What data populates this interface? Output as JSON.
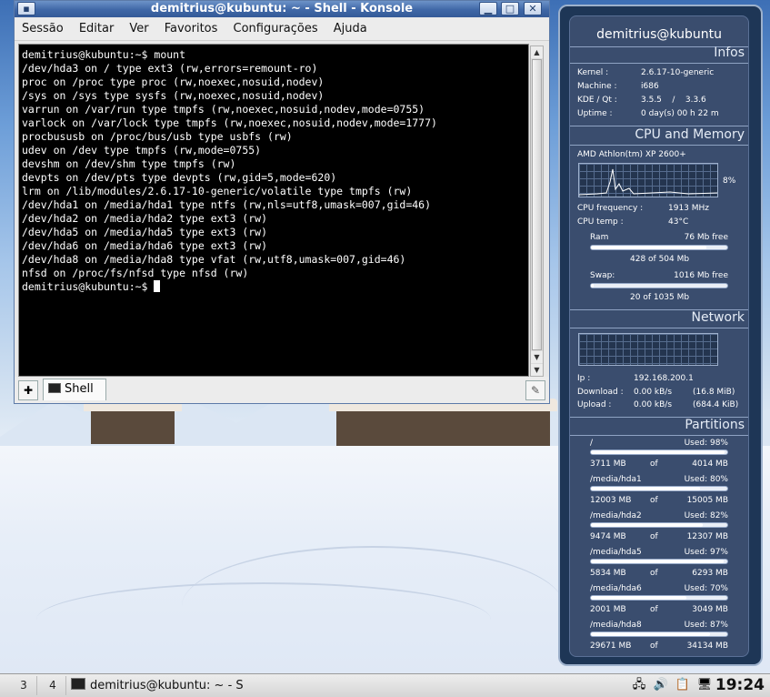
{
  "window": {
    "title": "demitrius@kubuntu: ~ - Shell - Konsole",
    "menu": [
      "Sessão",
      "Editar",
      "Ver",
      "Favoritos",
      "Configurações",
      "Ajuda"
    ]
  },
  "terminal": {
    "lines": [
      "demitrius@kubuntu:~$ mount",
      "/dev/hda3 on / type ext3 (rw,errors=remount-ro)",
      "proc on /proc type proc (rw,noexec,nosuid,nodev)",
      "/sys on /sys type sysfs (rw,noexec,nosuid,nodev)",
      "varrun on /var/run type tmpfs (rw,noexec,nosuid,nodev,mode=0755)",
      "varlock on /var/lock type tmpfs (rw,noexec,nosuid,nodev,mode=1777)",
      "procbususb on /proc/bus/usb type usbfs (rw)",
      "udev on /dev type tmpfs (rw,mode=0755)",
      "devshm on /dev/shm type tmpfs (rw)",
      "devpts on /dev/pts type devpts (rw,gid=5,mode=620)",
      "lrm on /lib/modules/2.6.17-10-generic/volatile type tmpfs (rw)",
      "/dev/hda1 on /media/hda1 type ntfs (rw,nls=utf8,umask=007,gid=46)",
      "/dev/hda2 on /media/hda2 type ext3 (rw)",
      "/dev/hda5 on /media/hda5 type ext3 (rw)",
      "/dev/hda6 on /media/hda6 type ext3 (rw)",
      "/dev/hda8 on /media/hda8 type vfat (rw,utf8,umask=007,gid=46)",
      "nfsd on /proc/fs/nfsd type nfsd (rw)"
    ],
    "prompt": "demitrius@kubuntu:~$ "
  },
  "tabs": [
    {
      "label": "Shell"
    }
  ],
  "monitor": {
    "hostname": "demitrius@kubuntu",
    "infos_title": "Infos",
    "kernel_label": "Kernel :",
    "kernel": "2.6.17-10-generic",
    "machine_label": "Machine :",
    "machine": "i686",
    "kde_label": "KDE / Qt :",
    "kde": "3.5.5",
    "kde_sep": "/",
    "qt": "3.3.6",
    "uptime_label": "Uptime :",
    "uptime": "0 day(s)  00 h 22 m",
    "cpu_title": "CPU and Memory",
    "cpu_model": "AMD Athlon(tm) XP 2600+",
    "cpu_usage": "8%",
    "cpu_freq_label": "CPU frequency :",
    "cpu_freq": "1913 MHz",
    "cpu_temp_label": "CPU temp :",
    "cpu_temp": "43°C",
    "ram_label": "Ram",
    "ram_free": "76 Mb free",
    "ram_used": "428 of 504 Mb",
    "ram_fraction": 0.849,
    "swap_label": "Swap:",
    "swap_free": "1016 Mb free",
    "swap_used": "20 of 1035 Mb",
    "swap_fraction": 0.019,
    "network_title": "Network",
    "ip_label": "Ip :",
    "ip": "192.168.200.1",
    "download_label": "Download :",
    "download_rate": "0.00 kB/s",
    "download_total": "(16.8 MiB)",
    "upload_label": "Upload :",
    "upload_rate": "0.00 kB/s",
    "upload_total": "(684.4 KiB)",
    "partitions_title": "Partitions",
    "of_label": "of",
    "partitions": [
      {
        "mount": "/",
        "used": "Used: 98%",
        "fraction": 0.98,
        "used_mb": "3711 MB",
        "total_mb": "4014 MB"
      },
      {
        "mount": "/media/hda1",
        "used": "Used: 80%",
        "fraction": 0.8,
        "used_mb": "12003 MB",
        "total_mb": "15005 MB"
      },
      {
        "mount": "/media/hda2",
        "used": "Used: 82%",
        "fraction": 0.82,
        "used_mb": "9474 MB",
        "total_mb": "12307 MB"
      },
      {
        "mount": "/media/hda5",
        "used": "Used: 97%",
        "fraction": 0.97,
        "used_mb": "5834 MB",
        "total_mb": "6293 MB"
      },
      {
        "mount": "/media/hda6",
        "used": "Used: 70%",
        "fraction": 0.7,
        "used_mb": "2001 MB",
        "total_mb": "3049 MB"
      },
      {
        "mount": "/media/hda8",
        "used": "Used: 87%",
        "fraction": 0.87,
        "used_mb": "29671 MB",
        "total_mb": "34134 MB"
      }
    ]
  },
  "taskbar": {
    "desktops": [
      "3",
      "4"
    ],
    "task_title": "demitrius@kubuntu: ~ - S",
    "clock": "19:24"
  }
}
